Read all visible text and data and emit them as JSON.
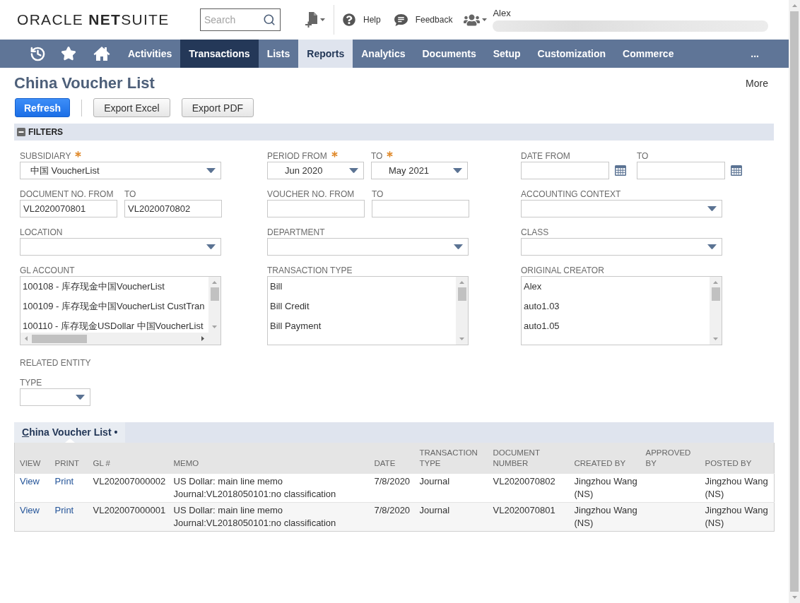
{
  "header": {
    "logo": "ORACLE **NET**SUITE",
    "search": {
      "placeholder": "Search"
    },
    "links": [
      {
        "kind": "help",
        "label": "Help"
      },
      {
        "kind": "feedback",
        "label": "Feedback"
      }
    ],
    "user": {
      "name": "Alex"
    }
  },
  "nav": {
    "items": [
      {
        "label": "Activities",
        "selected": false,
        "hovered": false
      },
      {
        "label": "Transactions",
        "selected": true,
        "hovered": false
      },
      {
        "label": "Lists",
        "selected": false,
        "hovered": false
      },
      {
        "label": "Reports",
        "selected": false,
        "hovered": true
      },
      {
        "label": "Analytics",
        "selected": false,
        "hovered": false
      },
      {
        "label": "Documents",
        "selected": false,
        "hovered": false
      },
      {
        "label": "Setup",
        "selected": false,
        "hovered": false
      },
      {
        "label": "Customization",
        "selected": false,
        "hovered": false
      },
      {
        "label": "Commerce",
        "selected": false,
        "hovered": false
      }
    ],
    "overflow": "..."
  },
  "page": {
    "title": "China Voucher List",
    "more": "More",
    "buttons": [
      {
        "label": "Refresh",
        "kind": "primary"
      },
      {
        "label": "Export Excel",
        "kind": "secondary"
      },
      {
        "label": "Export PDF",
        "kind": "secondary"
      }
    ]
  },
  "filters": {
    "title": "FILTERS",
    "expanded": true,
    "rows": [
      {
        "cells": [
          {
            "fields": [
              {
                "kind": "select",
                "label": "SUBSIDIARY",
                "required": true,
                "value": "中国 VoucherList"
              }
            ]
          },
          {
            "fields": [
              {
                "kind": "select",
                "label": "PERIOD FROM",
                "required": true,
                "value": "Jun 2020"
              },
              {
                "kind": "select",
                "label": "TO",
                "required": true,
                "value": "May 2021"
              }
            ]
          },
          {
            "fields": [
              {
                "kind": "date",
                "label": "DATE FROM",
                "required": false
              },
              {
                "kind": "date",
                "label": "TO",
                "required": false
              }
            ]
          }
        ]
      },
      {
        "cells": [
          {
            "fields": [
              {
                "kind": "text",
                "label": "DOCUMENT NO. FROM",
                "required": false,
                "value": "VL2020070801"
              },
              {
                "kind": "text",
                "label": "TO",
                "required": false,
                "value": "VL2020070802"
              }
            ]
          },
          {
            "fields": [
              {
                "kind": "text",
                "label": "VOUCHER NO. FROM",
                "required": false
              },
              {
                "kind": "text",
                "label": "TO",
                "required": false
              }
            ]
          },
          {
            "fields": [
              {
                "kind": "select",
                "label": "ACCOUNTING CONTEXT",
                "required": false
              }
            ]
          }
        ]
      },
      {
        "cells": [
          {
            "fields": [
              {
                "kind": "select",
                "label": "LOCATION",
                "required": false
              }
            ]
          },
          {
            "fields": [
              {
                "kind": "select",
                "label": "DEPARTMENT",
                "required": false
              }
            ]
          },
          {
            "fields": [
              {
                "kind": "select",
                "label": "CLASS",
                "required": false
              }
            ]
          }
        ]
      },
      {
        "cells": [
          {
            "fields": [
              {
                "kind": "listbox",
                "label": "GL ACCOUNT",
                "required": false,
                "options": [
                  {
                    "label": "100108 - 库存现金中国VoucherList",
                    "selected": false
                  },
                  {
                    "label": "100109 - 库存现金中国VoucherList CustTran",
                    "selected": false
                  },
                  {
                    "label": "100110 - 库存现金USDollar 中国VoucherList",
                    "selected": false
                  }
                ]
              }
            ]
          },
          {
            "fields": [
              {
                "kind": "listbox",
                "label": "TRANSACTION TYPE",
                "required": false,
                "options": [
                  {
                    "label": "Bill",
                    "selected": false
                  },
                  {
                    "label": "Bill Credit",
                    "selected": false
                  },
                  {
                    "label": "Bill Payment",
                    "selected": false
                  }
                ]
              }
            ]
          },
          {
            "fields": [
              {
                "kind": "listbox",
                "label": "ORIGINAL CREATOR",
                "required": false,
                "options": [
                  {
                    "label": "Alex",
                    "selected": false
                  },
                  {
                    "label": "auto1.03",
                    "selected": false
                  },
                  {
                    "label": "auto1.05",
                    "selected": false
                  }
                ]
              }
            ]
          }
        ]
      },
      {
        "cells": [
          {
            "fields": [
              {
                "kind": "group",
                "label": "RELATED ENTITY",
                "fields": [
                  {
                    "kind": "select",
                    "label": "TYPE",
                    "required": false
                  }
                ]
              }
            ]
          }
        ]
      }
    ]
  },
  "list": {
    "tabs": [
      {
        "label": "China Voucher List •",
        "selected": true
      }
    ],
    "columns": [
      "VIEW",
      "PRINT",
      "GL #",
      "MEMO",
      "DATE",
      "TRANSACTION TYPE",
      "DOCUMENT NUMBER",
      "CREATED BY",
      "APPROVED BY",
      "POSTED BY"
    ],
    "rows": [
      {
        "view": "View",
        "print": "Print",
        "gl_number": "VL202007000002",
        "memo": "US Dollar: main line memo Journal:VL2018050101:no classification",
        "date": "7/8/2020",
        "transaction_type": "Journal",
        "document_number": "VL2020070802",
        "created_by": "Jingzhou Wang (NS)",
        "posted_by": "Jingzhou Wang (NS)"
      },
      {
        "view": "View",
        "print": "Print",
        "gl_number": "VL202007000001",
        "memo": "US Dollar: main line memo Journal:VL2018050101:no classification",
        "date": "7/8/2020",
        "transaction_type": "Journal",
        "document_number": "VL2020070801",
        "created_by": "Jingzhou Wang (NS)",
        "posted_by": "Jingzhou Wang (NS)"
      }
    ]
  }
}
